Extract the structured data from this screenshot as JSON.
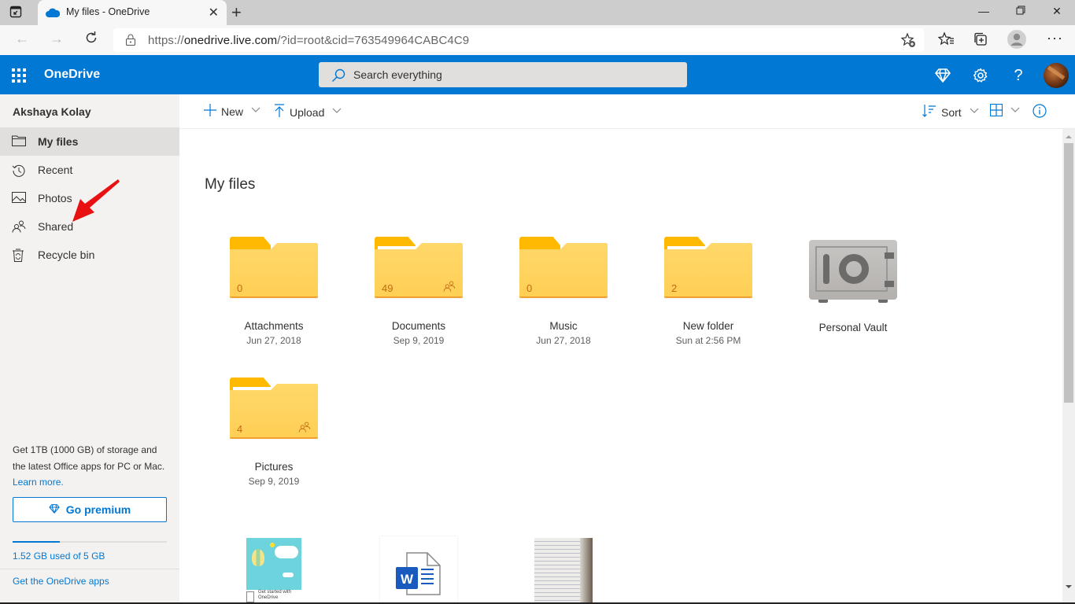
{
  "browser": {
    "tab_title": "My files - OneDrive",
    "url_prefix": "https://",
    "url_host": "onedrive.live.com",
    "url_path": "/?id=root&cid=763549964CABC4C9"
  },
  "header": {
    "app_name": "OneDrive",
    "search_placeholder": "Search everything",
    "brand_color": "#0078d4"
  },
  "sidebar": {
    "user_name": "Akshaya Kolay",
    "items": [
      {
        "label": "My files",
        "icon": "folder-icon",
        "selected": true
      },
      {
        "label": "Recent",
        "icon": "history-icon"
      },
      {
        "label": "Photos",
        "icon": "photo-icon"
      },
      {
        "label": "Shared",
        "icon": "people-icon"
      },
      {
        "label": "Recycle bin",
        "icon": "recycle-bin-icon"
      }
    ],
    "promo_text": "Get 1TB (1000 GB) of storage and the latest Office apps for PC or Mac.",
    "learn_more": "Learn more.",
    "premium_button": "Go premium",
    "storage_used_fraction": 0.304,
    "storage_text": "1.52 GB used of 5 GB",
    "apps_link": "Get the OneDrive apps"
  },
  "command_bar": {
    "new_label": "New",
    "upload_label": "Upload",
    "sort_label": "Sort"
  },
  "main": {
    "title": "My files",
    "folders": [
      {
        "name": "Attachments",
        "date": "Jun 27, 2018",
        "count": "0",
        "shared": false,
        "has_paper": false
      },
      {
        "name": "Documents",
        "date": "Sep 9, 2019",
        "count": "49",
        "shared": true,
        "has_paper": true
      },
      {
        "name": "Music",
        "date": "Jun 27, 2018",
        "count": "0",
        "shared": false,
        "has_paper": false
      },
      {
        "name": "New folder",
        "date": "Sun at 2:56 PM",
        "count": "2",
        "shared": false,
        "has_paper": true
      },
      {
        "name": "Personal Vault",
        "date": "",
        "type": "vault"
      },
      {
        "name": "Pictures",
        "date": "Sep 9, 2019",
        "count": "4",
        "shared": true,
        "has_paper": true
      }
    ],
    "files": [
      {
        "type": "pdf-thumbnail",
        "caption": "Get started with OneDrive"
      },
      {
        "type": "word-document",
        "caption": ""
      },
      {
        "type": "image-thumbnail",
        "caption": ""
      }
    ]
  },
  "annotation": {
    "color": "#e81010",
    "points_to": "Shared"
  }
}
